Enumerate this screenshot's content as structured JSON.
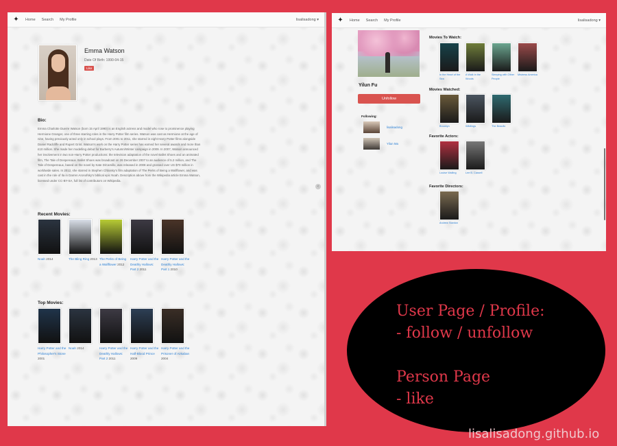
{
  "nav": {
    "home": "Home",
    "search": "Search",
    "profile": "My Profile",
    "user": "lisalisadong"
  },
  "person": {
    "name": "Emma Watson",
    "dob": "Date Of Birth: 1990-04-15",
    "like": "Like",
    "bio_title": "Bio:",
    "bio": "Emma Charlotte Duerre Watson (born 15 April 1990) is an English actress and model who rose to prominence playing Hermione Granger, one of three starring roles in the Harry Potter film series. Watson was cast as Hermione at the age of nine, having previously acted only in school plays. From 2001 to 2011, she starred in eight Harry Potter films alongside Daniel Radcliffe and Rupert Grint. Watson's work on the Harry Potter series has earned her several awards and more than £10 million. She made her modelling debut for Burberry's Autumn/Winter campaign in 2009. In 2007, Watson announced her involvement in two non-Harry Potter productions: the television adaptation of the novel Ballet Shoes and an animated film, The Tale of Despereaux. Ballet Shoes was broadcast on 26 December 2007 to an audience of 5.2 million, and The Tale of Despereaux, based on the novel by Kate DiCamillo, was released in 2008 and grossed over US $70 million in worldwide sales. In 2012, she starred in Stephen Chbosky's film adaptation of The Perks of Being a Wallflower, and was cast in the role of Ila in Darren Aronofsky's biblical epic Noah. Description above from the Wikipedia article Emma Watson, licensed under CC-BY-SA, full list of contributors on Wikipedia.",
    "recent_title": "Recent Movies:",
    "recent": [
      {
        "title": "Noah",
        "year": "2014",
        "color": "#2b3440"
      },
      {
        "title": "The Bling Ring",
        "year": "2013",
        "color": "#d9dfe8"
      },
      {
        "title": "The Perks of Being a Wallflower",
        "year": "2012",
        "color": "#b8cc35"
      },
      {
        "title": "Harry Potter and the Deathly Hallows: Part 2",
        "year": "2011",
        "color": "#3d3a44"
      },
      {
        "title": "Harry Potter and the Deathly Hallows: Part 1",
        "year": "2010",
        "color": "#4a3428"
      }
    ],
    "top_title": "Top Movies:",
    "top": [
      {
        "title": "Harry Potter and the Philosopher's Stone",
        "year": "2001",
        "color": "#20344a"
      },
      {
        "title": "Noah",
        "year": "2014",
        "color": "#2b3440"
      },
      {
        "title": "Harry Potter and the Deathly Hallows: Part 2",
        "year": "2011",
        "color": "#3d3a44"
      },
      {
        "title": "Harry Potter and the Half-Blood Prince",
        "year": "2009",
        "color": "#2d3f55"
      },
      {
        "title": "Harry Potter and the Prisoner of Azkaban",
        "year": "2004",
        "color": "#3a2e26"
      }
    ]
  },
  "profile": {
    "name": "Yilun Fu",
    "unfollow": "Unfollow",
    "following_title": "Following:",
    "following": [
      {
        "name": "lisalisadong"
      },
      {
        "name": "Yilun Ma"
      }
    ],
    "to_watch_title": "Movies To Watch:",
    "to_watch": [
      {
        "title": "In the Heart of the Sea",
        "color": "#17434a"
      },
      {
        "title": "A Walk in the Woods",
        "color": "#6f7d3a"
      },
      {
        "title": "Sleeping with Other People",
        "color": "#6ba58f"
      },
      {
        "title": "Mistress America",
        "color": "#9a4a4a"
      }
    ],
    "watched_title": "Movies Watched:",
    "watched": [
      {
        "title": "Brooklyn",
        "color": "#6a5a3a"
      },
      {
        "title": "Wildlings",
        "color": "#4b5560"
      },
      {
        "title": "The Beaufiz",
        "color": "#2f6a70"
      }
    ],
    "actors_title": "Favorite Actors:",
    "actors": [
      {
        "name": "Louise Walling",
        "color": "#b03040"
      },
      {
        "name": "Lee B. Cassell",
        "color": "#777777"
      }
    ],
    "directors_title": "Favorite Directors:",
    "directors": [
      {
        "name": "Andrew Stanton",
        "color": "#7a6a50"
      }
    ]
  },
  "note": {
    "line1": "User Page / Profile:",
    "line2": "- follow / unfollow",
    "line3": "Person Page",
    "line4": "- like"
  },
  "footer": "lisalisadong.github.io"
}
